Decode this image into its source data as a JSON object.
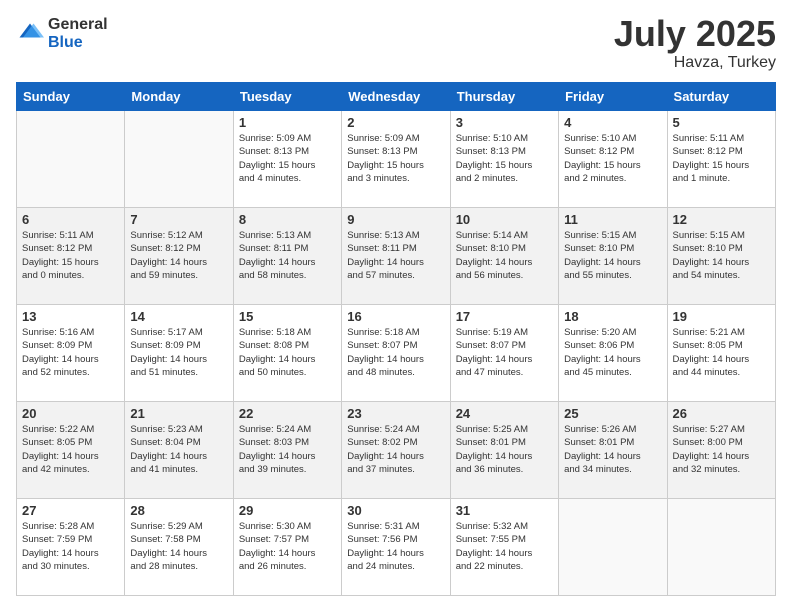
{
  "logo": {
    "general": "General",
    "blue": "Blue"
  },
  "header": {
    "month": "July 2025",
    "location": "Havza, Turkey"
  },
  "weekdays": [
    "Sunday",
    "Monday",
    "Tuesday",
    "Wednesday",
    "Thursday",
    "Friday",
    "Saturday"
  ],
  "weeks": [
    [
      {
        "day": "",
        "info": ""
      },
      {
        "day": "",
        "info": ""
      },
      {
        "day": "1",
        "info": "Sunrise: 5:09 AM\nSunset: 8:13 PM\nDaylight: 15 hours\nand 4 minutes."
      },
      {
        "day": "2",
        "info": "Sunrise: 5:09 AM\nSunset: 8:13 PM\nDaylight: 15 hours\nand 3 minutes."
      },
      {
        "day": "3",
        "info": "Sunrise: 5:10 AM\nSunset: 8:13 PM\nDaylight: 15 hours\nand 2 minutes."
      },
      {
        "day": "4",
        "info": "Sunrise: 5:10 AM\nSunset: 8:12 PM\nDaylight: 15 hours\nand 2 minutes."
      },
      {
        "day": "5",
        "info": "Sunrise: 5:11 AM\nSunset: 8:12 PM\nDaylight: 15 hours\nand 1 minute."
      }
    ],
    [
      {
        "day": "6",
        "info": "Sunrise: 5:11 AM\nSunset: 8:12 PM\nDaylight: 15 hours\nand 0 minutes."
      },
      {
        "day": "7",
        "info": "Sunrise: 5:12 AM\nSunset: 8:12 PM\nDaylight: 14 hours\nand 59 minutes."
      },
      {
        "day": "8",
        "info": "Sunrise: 5:13 AM\nSunset: 8:11 PM\nDaylight: 14 hours\nand 58 minutes."
      },
      {
        "day": "9",
        "info": "Sunrise: 5:13 AM\nSunset: 8:11 PM\nDaylight: 14 hours\nand 57 minutes."
      },
      {
        "day": "10",
        "info": "Sunrise: 5:14 AM\nSunset: 8:10 PM\nDaylight: 14 hours\nand 56 minutes."
      },
      {
        "day": "11",
        "info": "Sunrise: 5:15 AM\nSunset: 8:10 PM\nDaylight: 14 hours\nand 55 minutes."
      },
      {
        "day": "12",
        "info": "Sunrise: 5:15 AM\nSunset: 8:10 PM\nDaylight: 14 hours\nand 54 minutes."
      }
    ],
    [
      {
        "day": "13",
        "info": "Sunrise: 5:16 AM\nSunset: 8:09 PM\nDaylight: 14 hours\nand 52 minutes."
      },
      {
        "day": "14",
        "info": "Sunrise: 5:17 AM\nSunset: 8:09 PM\nDaylight: 14 hours\nand 51 minutes."
      },
      {
        "day": "15",
        "info": "Sunrise: 5:18 AM\nSunset: 8:08 PM\nDaylight: 14 hours\nand 50 minutes."
      },
      {
        "day": "16",
        "info": "Sunrise: 5:18 AM\nSunset: 8:07 PM\nDaylight: 14 hours\nand 48 minutes."
      },
      {
        "day": "17",
        "info": "Sunrise: 5:19 AM\nSunset: 8:07 PM\nDaylight: 14 hours\nand 47 minutes."
      },
      {
        "day": "18",
        "info": "Sunrise: 5:20 AM\nSunset: 8:06 PM\nDaylight: 14 hours\nand 45 minutes."
      },
      {
        "day": "19",
        "info": "Sunrise: 5:21 AM\nSunset: 8:05 PM\nDaylight: 14 hours\nand 44 minutes."
      }
    ],
    [
      {
        "day": "20",
        "info": "Sunrise: 5:22 AM\nSunset: 8:05 PM\nDaylight: 14 hours\nand 42 minutes."
      },
      {
        "day": "21",
        "info": "Sunrise: 5:23 AM\nSunset: 8:04 PM\nDaylight: 14 hours\nand 41 minutes."
      },
      {
        "day": "22",
        "info": "Sunrise: 5:24 AM\nSunset: 8:03 PM\nDaylight: 14 hours\nand 39 minutes."
      },
      {
        "day": "23",
        "info": "Sunrise: 5:24 AM\nSunset: 8:02 PM\nDaylight: 14 hours\nand 37 minutes."
      },
      {
        "day": "24",
        "info": "Sunrise: 5:25 AM\nSunset: 8:01 PM\nDaylight: 14 hours\nand 36 minutes."
      },
      {
        "day": "25",
        "info": "Sunrise: 5:26 AM\nSunset: 8:01 PM\nDaylight: 14 hours\nand 34 minutes."
      },
      {
        "day": "26",
        "info": "Sunrise: 5:27 AM\nSunset: 8:00 PM\nDaylight: 14 hours\nand 32 minutes."
      }
    ],
    [
      {
        "day": "27",
        "info": "Sunrise: 5:28 AM\nSunset: 7:59 PM\nDaylight: 14 hours\nand 30 minutes."
      },
      {
        "day": "28",
        "info": "Sunrise: 5:29 AM\nSunset: 7:58 PM\nDaylight: 14 hours\nand 28 minutes."
      },
      {
        "day": "29",
        "info": "Sunrise: 5:30 AM\nSunset: 7:57 PM\nDaylight: 14 hours\nand 26 minutes."
      },
      {
        "day": "30",
        "info": "Sunrise: 5:31 AM\nSunset: 7:56 PM\nDaylight: 14 hours\nand 24 minutes."
      },
      {
        "day": "31",
        "info": "Sunrise: 5:32 AM\nSunset: 7:55 PM\nDaylight: 14 hours\nand 22 minutes."
      },
      {
        "day": "",
        "info": ""
      },
      {
        "day": "",
        "info": ""
      }
    ]
  ]
}
